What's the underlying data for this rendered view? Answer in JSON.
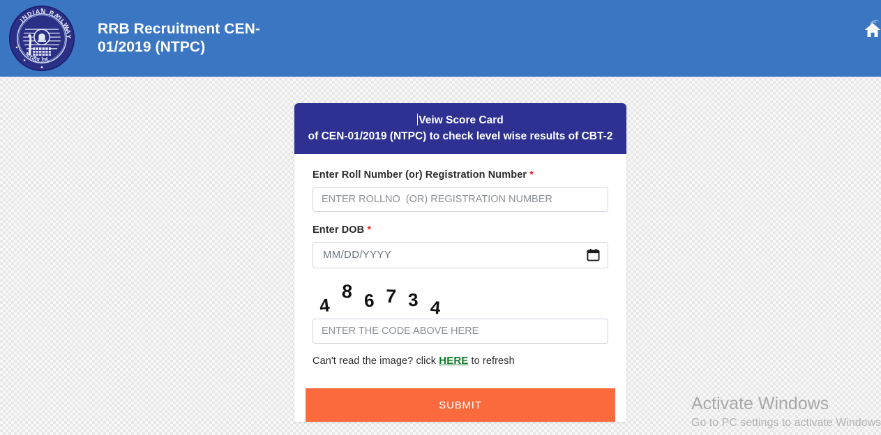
{
  "header": {
    "title": "RRB Recruitment CEN-\n01/2019 (NTPC)",
    "logo_alt": "Indian Railways emblem",
    "logo_text_top": "INDIAN RAILWAYS",
    "home_icon": "home-icon",
    "bar_color": "#3b76c3"
  },
  "card": {
    "header_line1": "Veiw Score Card",
    "header_line2": "of CEN-01/2019 (NTPC) to check level wise results of CBT-2",
    "header_color": "#2e3192"
  },
  "form": {
    "rollno": {
      "label": "Enter Roll Number (or) Registration Number",
      "required_mark": "*",
      "placeholder": "ENTER ROLLNO  (OR) REGISTRATION NUMBER",
      "value": ""
    },
    "dob": {
      "label": "Enter DOB",
      "required_mark": "*",
      "placeholder": "MM/DD/YYYY",
      "value": "",
      "picker_icon": "calendar-icon"
    },
    "captcha": {
      "code": "486734",
      "digits": [
        "4",
        "8",
        "6",
        "7",
        "3",
        "4"
      ],
      "placeholder": "ENTER THE CODE ABOVE HERE",
      "value": "",
      "hint_before": "Can't read the image? click ",
      "hint_link": "HERE",
      "hint_after": " to refresh",
      "link_color": "#117a2b"
    },
    "submit": {
      "label": "SUBMIT",
      "color": "#fb6a3c"
    }
  },
  "watermark": {
    "title": "Activate Windows",
    "subtitle": "Go to PC settings to activate Windows"
  }
}
